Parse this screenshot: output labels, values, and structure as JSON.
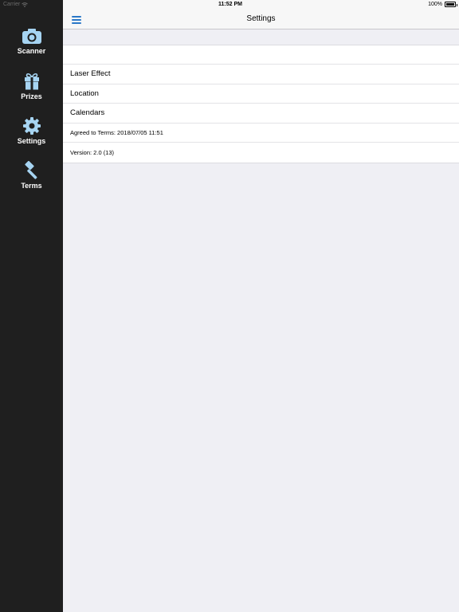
{
  "status_bar": {
    "carrier": "Carrier",
    "time": "11:52 PM",
    "battery": "100%"
  },
  "sidebar": {
    "items": [
      {
        "label": "Scanner",
        "icon": "camera-icon"
      },
      {
        "label": "Prizes",
        "icon": "gift-icon"
      },
      {
        "label": "Settings",
        "icon": "gear-icon"
      },
      {
        "label": "Terms",
        "icon": "gavel-icon"
      }
    ]
  },
  "nav": {
    "title": "Settings",
    "menu_icon": "hamburger-menu-icon",
    "accent": "#2a78c8"
  },
  "settings": {
    "rows": [
      {
        "label": ""
      },
      {
        "label": "Laser Effect"
      },
      {
        "label": "Location"
      },
      {
        "label": "Calendars"
      },
      {
        "label": "Agreed to Terms: 2018/07/05 11:51"
      },
      {
        "label": "Version: 2.0 (13)"
      }
    ]
  },
  "colors": {
    "sidebar_bg": "#1f1f1f",
    "sidebar_icon": "#a6d4f2",
    "page_bg": "#efeff4"
  }
}
